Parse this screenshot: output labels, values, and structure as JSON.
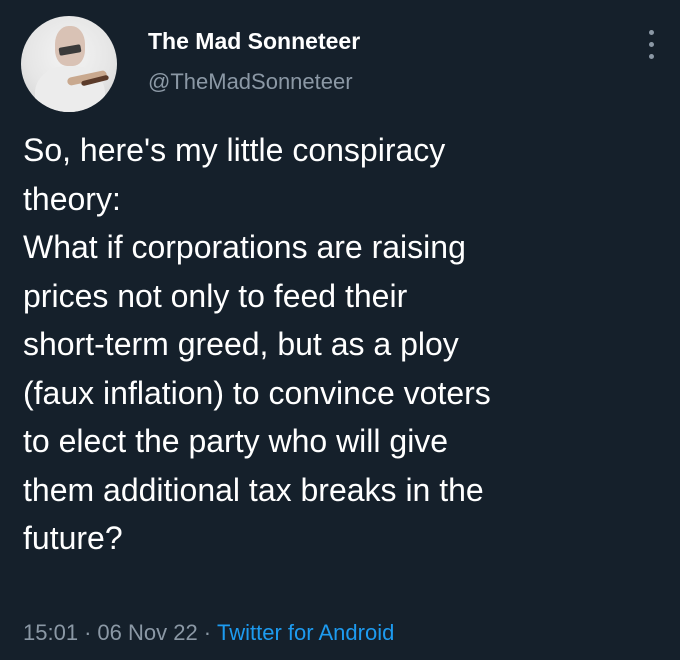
{
  "author": {
    "display_name": "The Mad Sonneteer",
    "handle": "@TheMadSonneteer"
  },
  "tweet": {
    "text": "So, here's my little conspiracy\ntheory:\nWhat if corporations are raising\nprices not only to feed their\nshort-term greed, but as a ploy\n(faux inflation) to convince voters\nto elect the party who will give\nthem additional tax breaks in the\nfuture?"
  },
  "meta": {
    "time": "15:01",
    "separator": "·",
    "date": "06 Nov 22",
    "source": "Twitter for Android"
  },
  "icons": {
    "more": "vertical-ellipsis-icon"
  },
  "colors": {
    "background": "#15202b",
    "text": "#ffffff",
    "secondary": "#8b98a5",
    "link": "#1d9bf0"
  }
}
